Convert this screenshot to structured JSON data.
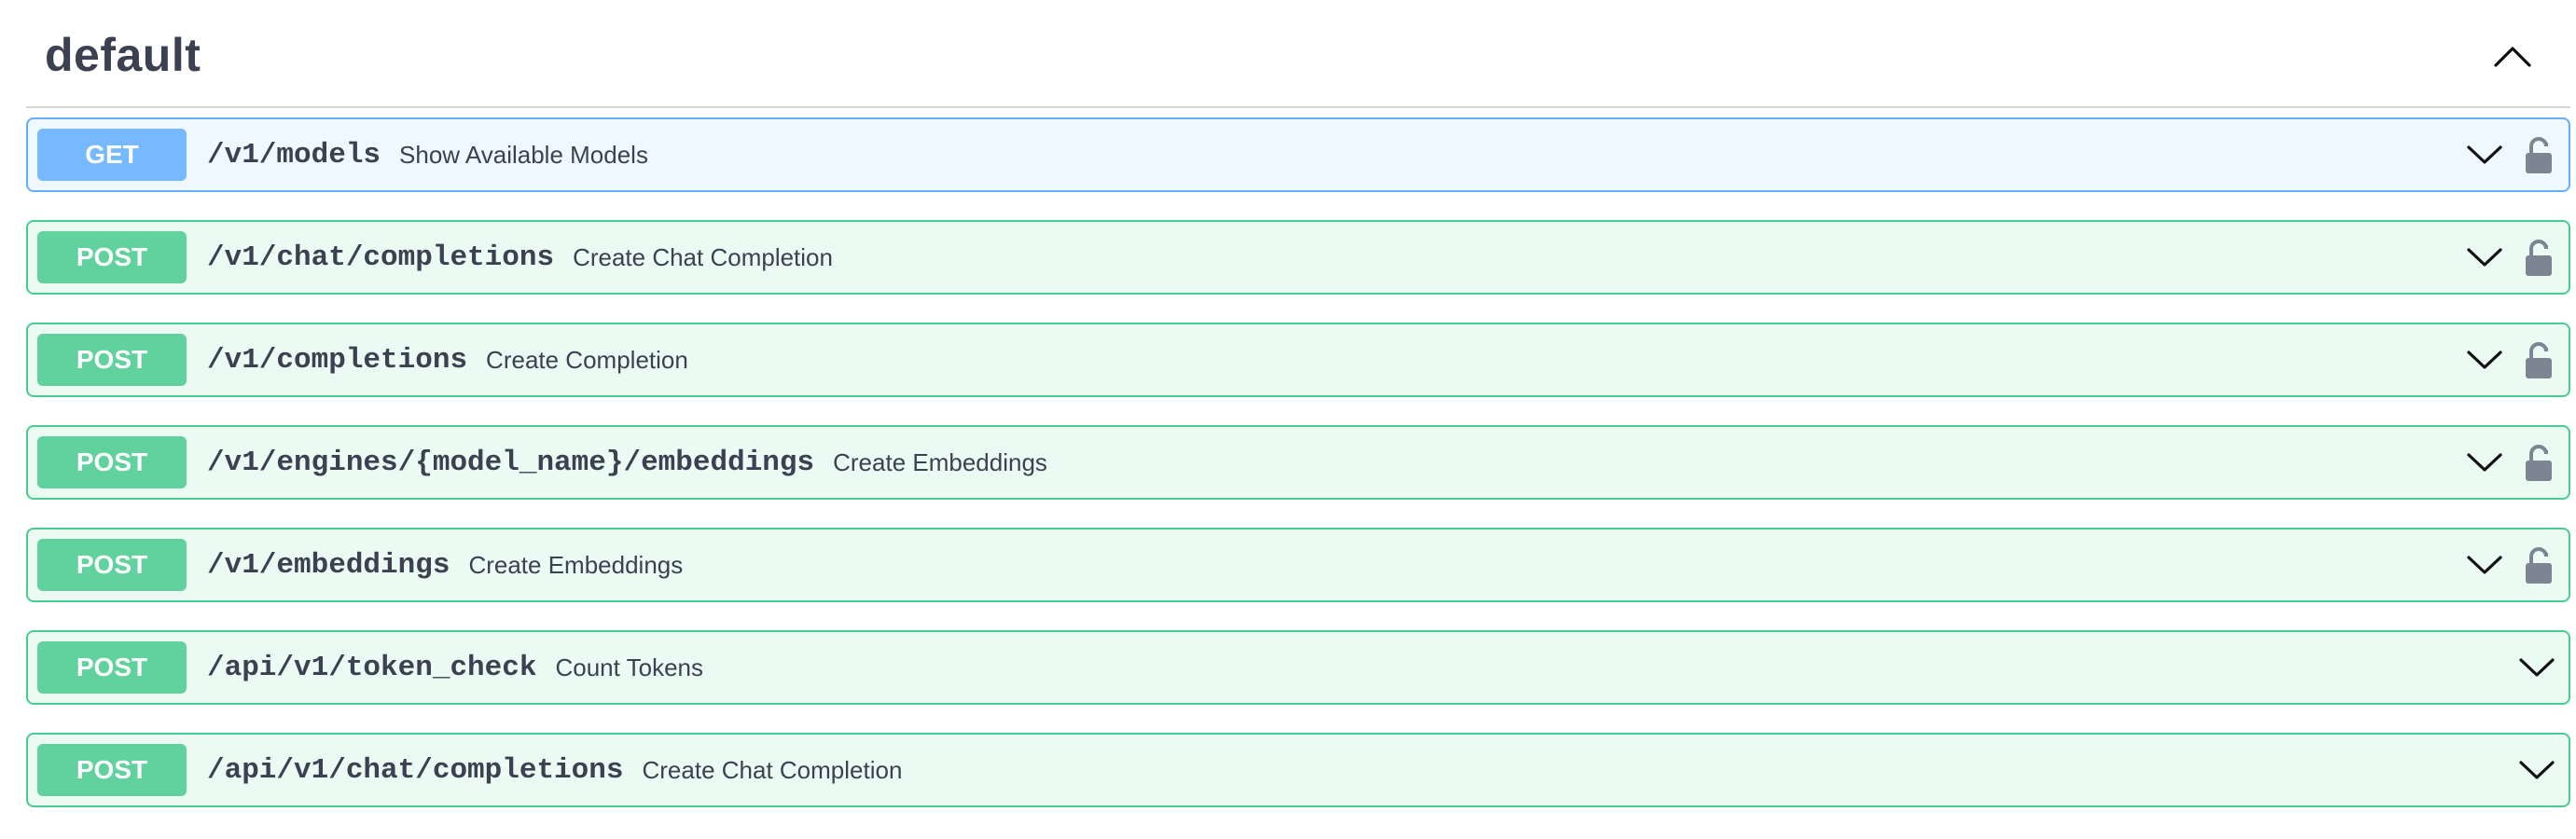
{
  "section": {
    "title": "default",
    "collapsed_icon": "chevron-up-icon"
  },
  "colors": {
    "get": "#61affe",
    "post": "#49cc90",
    "text": "#3b4151",
    "lock": "#7d8492"
  },
  "operations": [
    {
      "method": "GET",
      "path": "/v1/models",
      "summary": "Show Available Models",
      "locked": true
    },
    {
      "method": "POST",
      "path": "/v1/chat/completions",
      "summary": "Create Chat Completion",
      "locked": true
    },
    {
      "method": "POST",
      "path": "/v1/completions",
      "summary": "Create Completion",
      "locked": true
    },
    {
      "method": "POST",
      "path": "/v1/engines/{model_name}/embeddings",
      "summary": "Create Embeddings",
      "locked": true
    },
    {
      "method": "POST",
      "path": "/v1/embeddings",
      "summary": "Create Embeddings",
      "locked": true
    },
    {
      "method": "POST",
      "path": "/api/v1/token_check",
      "summary": "Count Tokens",
      "locked": false
    },
    {
      "method": "POST",
      "path": "/api/v1/chat/completions",
      "summary": "Create Chat Completion",
      "locked": false
    }
  ]
}
